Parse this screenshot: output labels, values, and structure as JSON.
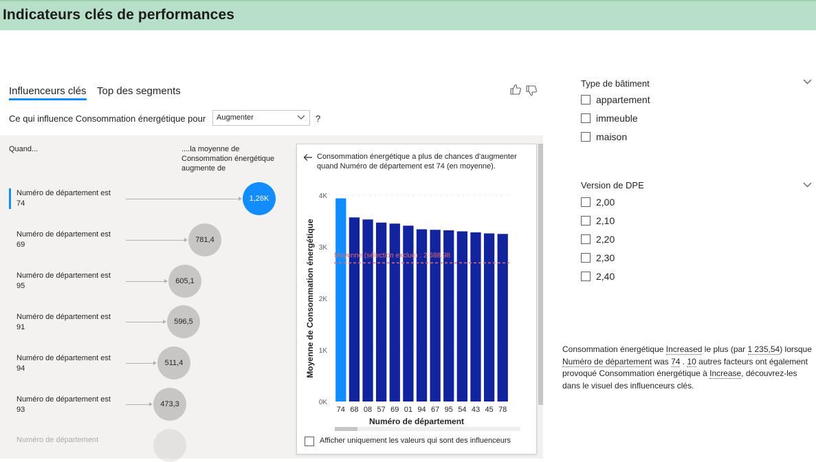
{
  "page": {
    "title": "Indicateurs clés de performances"
  },
  "tabs": [
    {
      "label": "Influenceurs clés",
      "active": true
    },
    {
      "label": "Top des segments",
      "active": false
    }
  ],
  "question": {
    "prefix": "Ce qui influence Consommation énergétique pour",
    "selected": "Augmenter",
    "help": "?"
  },
  "list_header": {
    "when": "Quand...",
    "avg": "....la moyenne de Consommation énergétique augmente de"
  },
  "influencers": [
    {
      "label": "Numéro de département est 74",
      "value": "1,26K",
      "selected": true
    },
    {
      "label": "Numéro de département est 69",
      "value": "781,4",
      "selected": false
    },
    {
      "label": "Numéro de département est 95",
      "value": "605,1",
      "selected": false
    },
    {
      "label": "Numéro de département est 91",
      "value": "596,5",
      "selected": false
    },
    {
      "label": "Numéro de département est 94",
      "value": "511,4",
      "selected": false
    },
    {
      "label": "Numéro de département est 93",
      "value": "473,3",
      "selected": false
    },
    {
      "label": "Numéro de département",
      "value": "",
      "selected": false
    }
  ],
  "detail": {
    "header": "Consommation énergétique a plus de chances d'augmenter quand Numéro de département est 74 (en moyenne).",
    "checkbox_label": "Afficher uniquement les valeurs qui sont des influenceurs"
  },
  "chart_data": {
    "type": "bar",
    "categories": [
      "74",
      "68",
      "08",
      "57",
      "69",
      "01",
      "94",
      "67",
      "95",
      "54",
      "43",
      "45",
      "78"
    ],
    "values": [
      3940,
      3570,
      3530,
      3470,
      3450,
      3410,
      3340,
      3330,
      3320,
      3300,
      3280,
      3260,
      3250
    ],
    "highlight_index": 0,
    "ylabel": "Moyenne de Consommation énergétique",
    "xlabel": "Numéro de département",
    "ylim": [
      0,
      4000
    ],
    "yticks": [
      0,
      1000,
      2000,
      3000,
      4000
    ],
    "ytick_labels": [
      "0K",
      "1K",
      "2K",
      "3K",
      "4K"
    ],
    "reference_line": {
      "value": 2688.98,
      "label": "Moyenne (sélection exclue) : 2 688,98"
    },
    "colors": {
      "highlight": "#118dff",
      "bar": "#12239e",
      "reference": "#e66c6c"
    }
  },
  "filters": [
    {
      "title": "Type de bâtiment",
      "options": [
        "appartement",
        "immeuble",
        "maison"
      ]
    },
    {
      "title": "Version de DPE",
      "options": [
        "2,00",
        "2,10",
        "2,20",
        "2,30",
        "2,40"
      ]
    }
  ],
  "summary": {
    "t1": "Consommation énergétique ",
    "t2": "Increased",
    "t3": " le plus (par ",
    "t4": "1 235,54",
    "t5": ")\nlorsque ",
    "t6": "Numéro de département",
    "t7": " was ",
    "t8": "74",
    "t9": " . ",
    "t10": "10",
    "t11": " autres facteurs ont également provoqué Consommation énergétique à ",
    "t12": "Increase",
    "t13": ", découvrez-les dans le visuel des influenceurs clés."
  },
  "colors": {
    "title_bar": "#b8e0c8",
    "accent": "#118dff"
  }
}
